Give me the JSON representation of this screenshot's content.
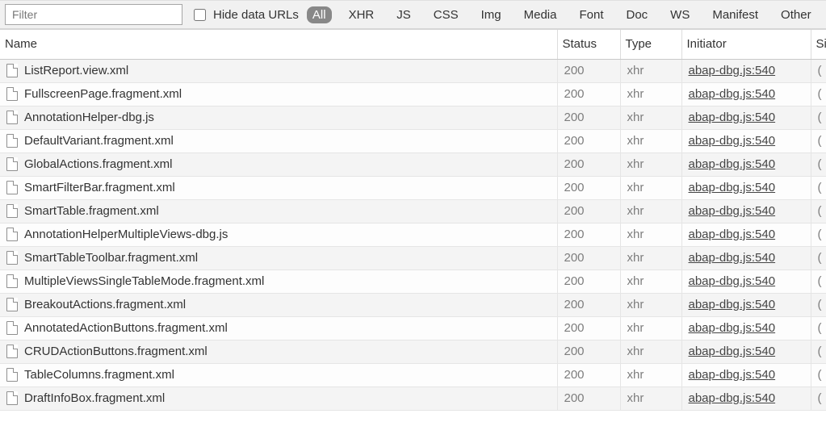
{
  "toolbar": {
    "filter_placeholder": "Filter",
    "hide_data_urls_label": "Hide data URLs",
    "type_filters": [
      "All",
      "XHR",
      "JS",
      "CSS",
      "Img",
      "Media",
      "Font",
      "Doc",
      "WS",
      "Manifest",
      "Other"
    ],
    "active_type_filter": "All"
  },
  "columns": {
    "name": "Name",
    "status": "Status",
    "type": "Type",
    "initiator": "Initiator",
    "size": "Si"
  },
  "rows": [
    {
      "name": "ListReport.view.xml",
      "status": "200",
      "type": "xhr",
      "initiator": "abap-dbg.js:540",
      "size": "("
    },
    {
      "name": "FullscreenPage.fragment.xml",
      "status": "200",
      "type": "xhr",
      "initiator": "abap-dbg.js:540",
      "size": "("
    },
    {
      "name": "AnnotationHelper-dbg.js",
      "status": "200",
      "type": "xhr",
      "initiator": "abap-dbg.js:540",
      "size": "("
    },
    {
      "name": "DefaultVariant.fragment.xml",
      "status": "200",
      "type": "xhr",
      "initiator": "abap-dbg.js:540",
      "size": "("
    },
    {
      "name": "GlobalActions.fragment.xml",
      "status": "200",
      "type": "xhr",
      "initiator": "abap-dbg.js:540",
      "size": "("
    },
    {
      "name": "SmartFilterBar.fragment.xml",
      "status": "200",
      "type": "xhr",
      "initiator": "abap-dbg.js:540",
      "size": "("
    },
    {
      "name": "SmartTable.fragment.xml",
      "status": "200",
      "type": "xhr",
      "initiator": "abap-dbg.js:540",
      "size": "("
    },
    {
      "name": "AnnotationHelperMultipleViews-dbg.js",
      "status": "200",
      "type": "xhr",
      "initiator": "abap-dbg.js:540",
      "size": "("
    },
    {
      "name": "SmartTableToolbar.fragment.xml",
      "status": "200",
      "type": "xhr",
      "initiator": "abap-dbg.js:540",
      "size": "("
    },
    {
      "name": "MultipleViewsSingleTableMode.fragment.xml",
      "status": "200",
      "type": "xhr",
      "initiator": "abap-dbg.js:540",
      "size": "("
    },
    {
      "name": "BreakoutActions.fragment.xml",
      "status": "200",
      "type": "xhr",
      "initiator": "abap-dbg.js:540",
      "size": "("
    },
    {
      "name": "AnnotatedActionButtons.fragment.xml",
      "status": "200",
      "type": "xhr",
      "initiator": "abap-dbg.js:540",
      "size": "("
    },
    {
      "name": "CRUDActionButtons.fragment.xml",
      "status": "200",
      "type": "xhr",
      "initiator": "abap-dbg.js:540",
      "size": "("
    },
    {
      "name": "TableColumns.fragment.xml",
      "status": "200",
      "type": "xhr",
      "initiator": "abap-dbg.js:540",
      "size": "("
    },
    {
      "name": "DraftInfoBox.fragment.xml",
      "status": "200",
      "type": "xhr",
      "initiator": "abap-dbg.js:540",
      "size": "("
    }
  ]
}
